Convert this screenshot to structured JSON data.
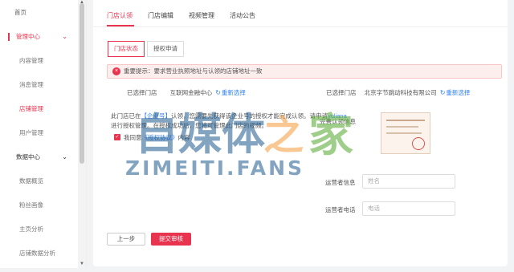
{
  "sidebar": {
    "home": "首页",
    "groups": [
      {
        "label": "管理中心",
        "items": [
          "内容管理",
          "消息管理",
          "店铺管理",
          "用户管理"
        ]
      },
      {
        "label": "数据中心",
        "items": [
          "数据概览",
          "粉丝画像",
          "主页分析",
          "店铺数据分析"
        ]
      }
    ],
    "current_item": "店铺管理"
  },
  "tabs": [
    "门店认领",
    "门店编辑",
    "视频管理",
    "活动公告"
  ],
  "active_tab": "门店认领",
  "segments": [
    "门店状态",
    "授权申请"
  ],
  "active_segment": "门店状态",
  "alert": "重要提示：要求营业执照地址与认领的店铺地址一致",
  "left_store": {
    "label": "已选择门店",
    "value": "互联网金融中心",
    "reselect": "重新选择"
  },
  "right_store": {
    "label": "已选择门店",
    "value": "北京字节跳动科技有限公司",
    "reselect": "重新选择"
  },
  "description": {
    "prefix": "此门店已在",
    "highlight1": "【企业号】",
    "middle": "认领，您需要先获得该企业号的授权才能完成认领。请申请",
    "highlight2": "yuliana",
    "suffix": "进行授权管理。在授权成功后，您将可管理此门店的视频。"
  },
  "agreement": {
    "prefix": "我同意",
    "link": "《授权协议》",
    "suffix": "内容"
  },
  "cert_label": "完善认领信息",
  "operator": {
    "name_label": "运营者信息",
    "name_placeholder": "姓名",
    "phone_label": "运营者电话",
    "phone_placeholder": "电话"
  },
  "buttons": {
    "prev": "上一步",
    "submit": "提交审核"
  },
  "watermark": {
    "main": "自媒体之家",
    "sub": "ZIMEITI.FANS"
  },
  "colors": {
    "accent": "#e8344e",
    "link": "#2d7ff9",
    "watermark_blue": "#1e5a8c",
    "watermark_orange": "#f3a14a",
    "watermark_green": "#5fae3e"
  }
}
